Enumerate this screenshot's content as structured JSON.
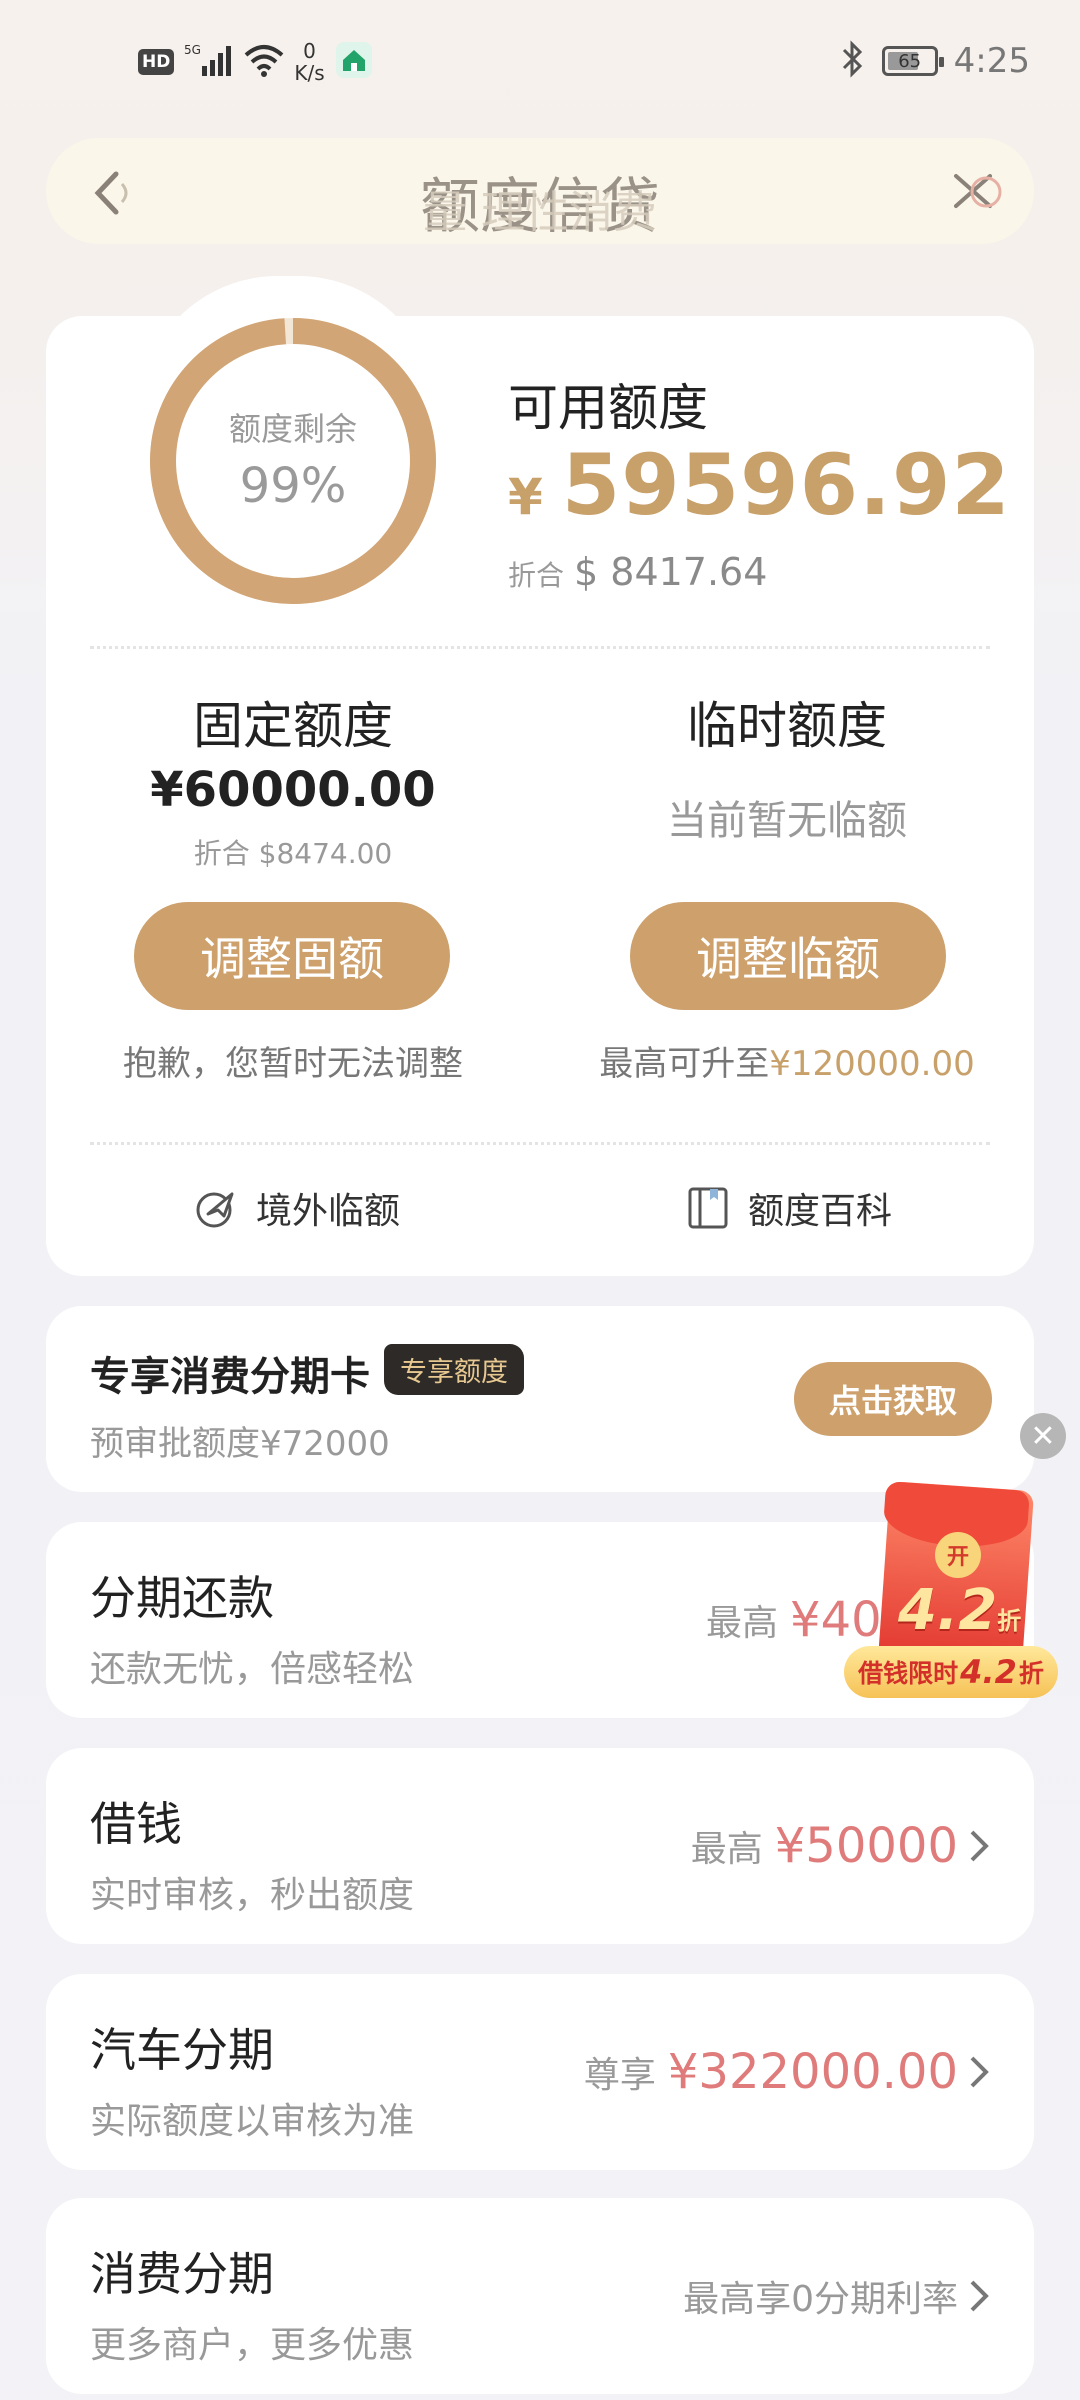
{
  "status_bar": {
    "hd": "HD",
    "network": "5G",
    "speed_value": "0",
    "speed_unit": "K/s",
    "battery": "65",
    "time": "4:25"
  },
  "header": {
    "title": "额度信贷",
    "ghost_text": "量                    理性消费"
  },
  "quota": {
    "ring_label": "额度剩余",
    "ring_percent": "99%",
    "ring_fraction": 0.99,
    "available_title": "可用额度",
    "currency": "¥",
    "available_amount": "59596.92",
    "converted_label": "折合",
    "converted_amount": "$ 8417.64",
    "fixed_title": "固定额度",
    "fixed_amount": "¥60000.00",
    "fixed_converted": "折合 $8474.00",
    "temp_title": "临时额度",
    "temp_status": "当前暂无临额",
    "adjust_fixed_label": "调整固额",
    "adjust_temp_label": "调整临额",
    "fixed_note": "抱歉，您暂时无法调整",
    "temp_note_prefix": "最高可升至",
    "temp_note_amount": "¥120000.00",
    "overseas_label": "境外临额",
    "encyclopedia_label": "额度百科"
  },
  "promo": {
    "title": "专享消费分期卡",
    "badge": "专享额度",
    "subtitle": "预审批额度¥72000",
    "button": "点击获取"
  },
  "services": [
    {
      "title": "分期还款",
      "subtitle": "还款无忧，倍感轻松",
      "prefix": "最高",
      "amount": "¥403.0"
    },
    {
      "title": "借钱",
      "subtitle": "实时审核，秒出额度",
      "prefix": "最高",
      "amount": "¥50000"
    },
    {
      "title": "汽车分期",
      "subtitle": "实际额度以审核为准",
      "prefix": "尊享",
      "amount": "¥322000.00"
    },
    {
      "title": "消费分期",
      "subtitle": "更多商户，更多优惠",
      "plain": "最高享0分期利率"
    }
  ],
  "floating_ad": {
    "coin": "开",
    "discount": "4.2",
    "unit": "折",
    "ribbon_prefix": "借钱限时",
    "ribbon_num": "4.2",
    "ribbon_suffix": "折",
    "close": "✕"
  },
  "colors": {
    "accent_gold": "#cda06c",
    "amount_red": "#e07b7b"
  }
}
